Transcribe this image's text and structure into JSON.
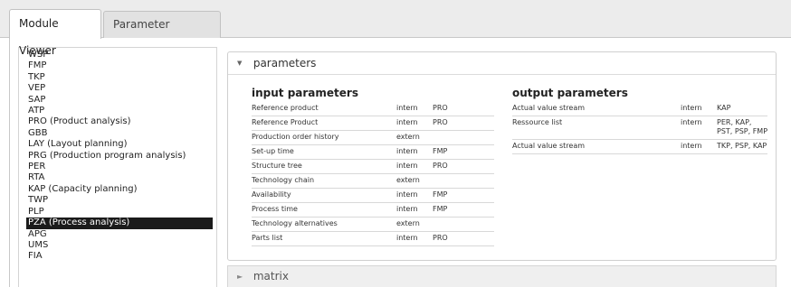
{
  "tabs": [
    {
      "label": "Module Viewer",
      "active": true
    },
    {
      "label": "Parameter Analysis",
      "active": false
    }
  ],
  "modules": {
    "items": [
      "WSP",
      "FMP",
      "TKP",
      "VEP",
      "SAP",
      "ATP",
      "PRO (Product analysis)",
      "GBB",
      "LAY (Layout planning)",
      "PRG (Production program analysis)",
      "PER",
      "RTA",
      "KAP (Capacity planning)",
      "TWP",
      "PLP",
      "PZA (Process analysis)",
      "APG",
      "UMS",
      "FIA"
    ],
    "selected_index": 15
  },
  "parameters_panel": {
    "header": "parameters",
    "expanded": true,
    "input": {
      "title": "input parameters",
      "rows": [
        {
          "name": "Reference product",
          "scope": "intern",
          "module": "PRO"
        },
        {
          "name": "Reference Product",
          "scope": "intern",
          "module": "PRO"
        },
        {
          "name": "Production order history",
          "scope": "extern",
          "module": ""
        },
        {
          "name": "Set-up time",
          "scope": "intern",
          "module": "FMP"
        },
        {
          "name": "Structure tree",
          "scope": "intern",
          "module": "PRO"
        },
        {
          "name": "Technology chain",
          "scope": "extern",
          "module": ""
        },
        {
          "name": "Availability",
          "scope": "intern",
          "module": "FMP"
        },
        {
          "name": "Process time",
          "scope": "intern",
          "module": "FMP"
        },
        {
          "name": "Technology alternatives",
          "scope": "extern",
          "module": ""
        },
        {
          "name": "Parts list",
          "scope": "intern",
          "module": "PRO"
        }
      ]
    },
    "output": {
      "title": "output parameters",
      "rows": [
        {
          "name": "Actual value stream",
          "scope": "intern",
          "module": "KAP"
        },
        {
          "name": "Ressource list",
          "scope": "intern",
          "module": "PER, KAP, PST, PSP, FMP"
        },
        {
          "name": "Actual value stream",
          "scope": "intern",
          "module": "TKP, PSP, KAP"
        }
      ]
    }
  },
  "matrix_panel": {
    "header": "matrix",
    "expanded": false
  },
  "colors": {
    "selected_bg": "#1b1b1b",
    "selected_text": "#ffffff",
    "matrix_bg": "#efefef"
  },
  "icons": {
    "expanded": "caret-down-icon",
    "collapsed": "caret-right-icon"
  }
}
